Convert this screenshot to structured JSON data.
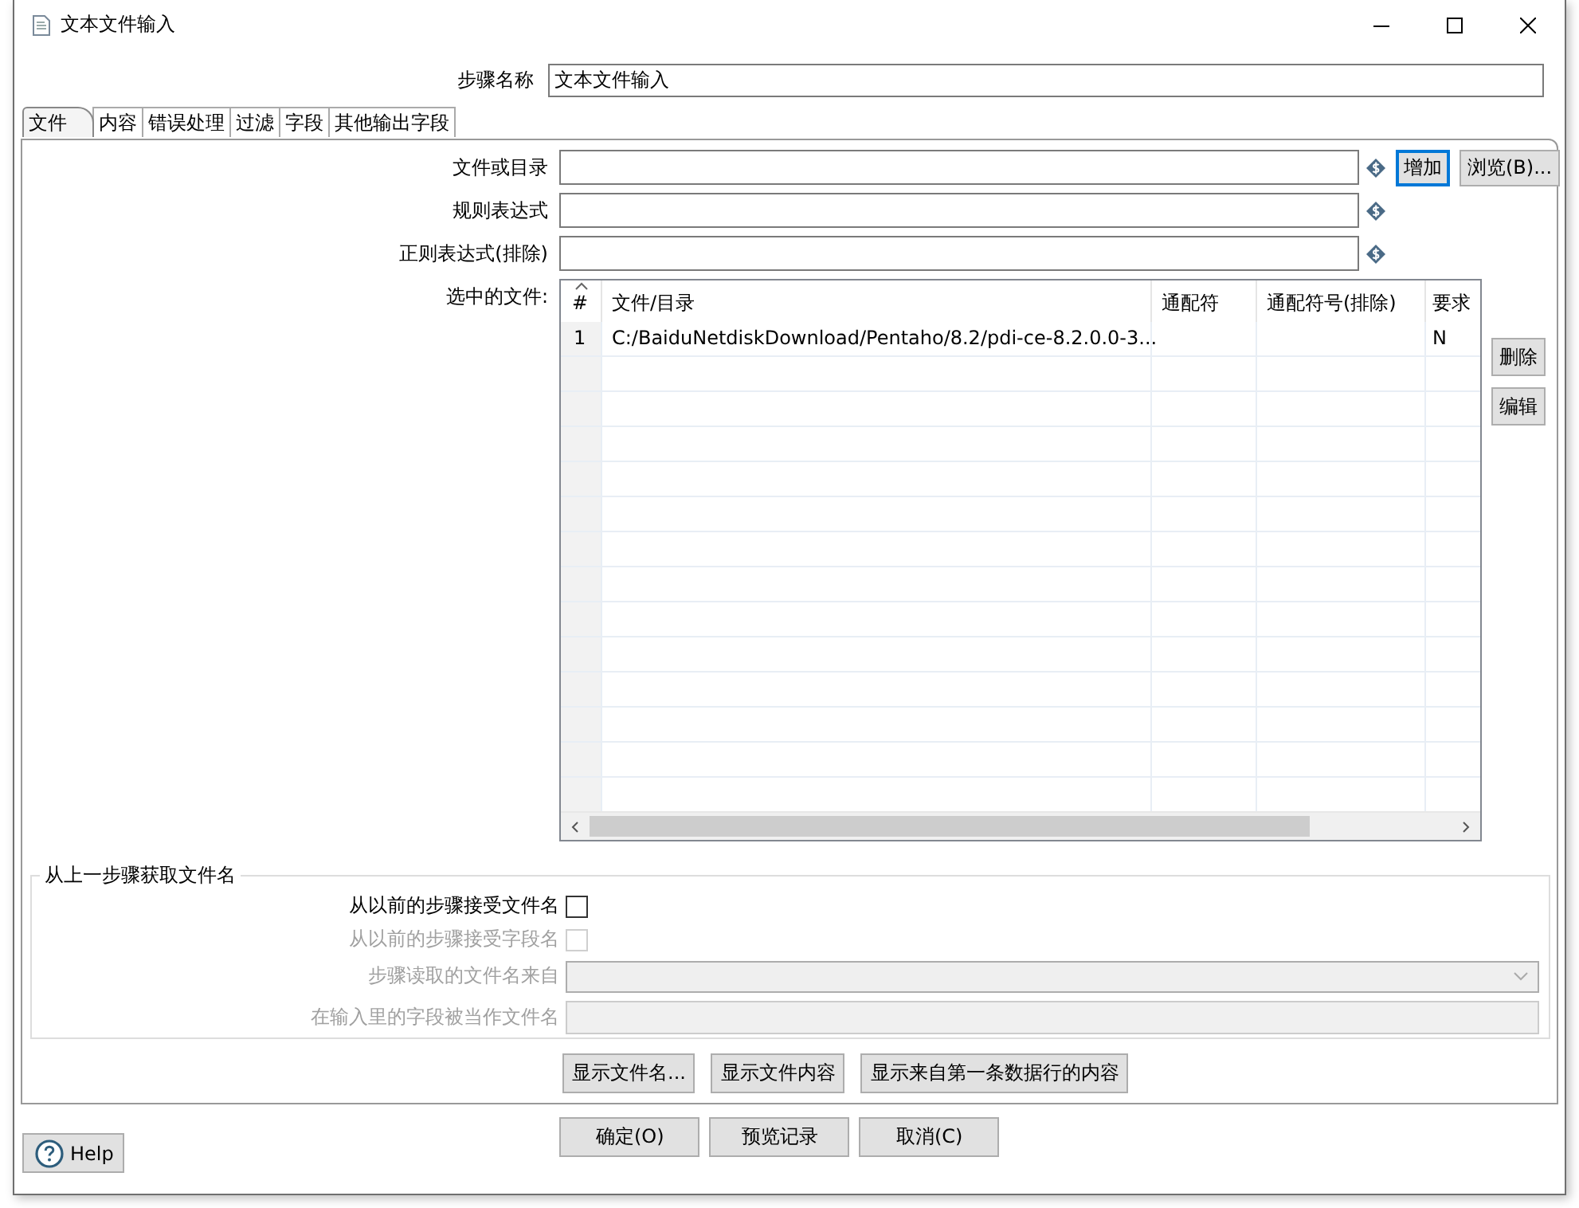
{
  "window": {
    "title": "文本文件输入"
  },
  "step_name": {
    "label": "步骤名称",
    "value": "文本文件输入"
  },
  "tabs": [
    {
      "label": "文件",
      "selected": true
    },
    {
      "label": "内容",
      "selected": false
    },
    {
      "label": "错误处理",
      "selected": false
    },
    {
      "label": "过滤",
      "selected": false
    },
    {
      "label": "字段",
      "selected": false
    },
    {
      "label": "其他输出字段",
      "selected": false
    }
  ],
  "file_fields": [
    {
      "label": "文件或目录",
      "buttons": [
        {
          "label": "增加",
          "focused": true
        },
        {
          "label": "浏览(B)...",
          "focused": false
        }
      ]
    },
    {
      "label": "规则表达式"
    },
    {
      "label": "正则表达式(排除)"
    }
  ],
  "selected_files": {
    "label": "选中的文件:",
    "columns": [
      "#",
      "文件/目录",
      "通配符",
      "通配符号(排除)",
      "要求"
    ],
    "rows": [
      {
        "cells": [
          "1",
          "C:/BaiduNetdiskDownload/Pentaho/8.2/pdi-ce-8.2.0.0-3...",
          null,
          null,
          "N"
        ]
      }
    ],
    "buttons": [
      "删除",
      "编辑"
    ]
  },
  "previous_step": {
    "title": "从上一步骤获取文件名",
    "rows": [
      {
        "kind": "checkbox",
        "label": "从以前的步骤接受文件名",
        "checked": false,
        "disabled": false
      },
      {
        "kind": "checkbox",
        "label": "从以前的步骤接受字段名",
        "checked": false,
        "disabled": true
      },
      {
        "kind": "combo",
        "label": "步骤读取的文件名来自",
        "disabled": true
      },
      {
        "kind": "text",
        "label": "在输入里的字段被当作文件名",
        "disabled": true
      }
    ]
  },
  "show_buttons": [
    "显示文件名...",
    "显示文件内容",
    "显示来自第一条数据行的内容"
  ],
  "footer_buttons": [
    "确定(O)",
    "预览记录",
    "取消(C)"
  ],
  "help_button": {
    "label": "Help"
  }
}
